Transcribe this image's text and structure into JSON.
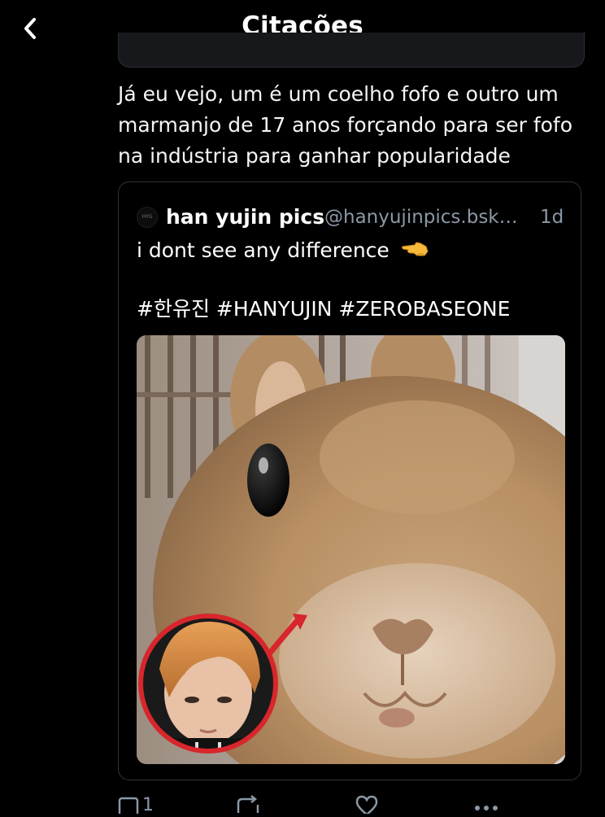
{
  "header": {
    "title": "Citações",
    "back_icon": "chevron-left-icon"
  },
  "post": {
    "text": "Já eu vejo, um é um coelho fofo e outro um marmanjo de 17 anos forçando para ser fofo na indústria para ganhar popularidade"
  },
  "quoted_post": {
    "avatar_text": "HYG",
    "author": "han yujin pics",
    "handle": "@hanyujinpics.bsk…",
    "time": "1d",
    "text": "i dont see any difference",
    "emoji_icon": "pointing-hand-icon",
    "hashtags": "#한유진 #HANYUJIN #ZEROBASEONE",
    "image_icon": "rabbit-photo"
  },
  "actions": {
    "reply_icon": "reply-icon",
    "reply_count": "1",
    "repost_icon": "repost-icon",
    "like_icon": "heart-icon",
    "more_icon": "more-icon"
  },
  "colors": {
    "background": "#000000",
    "text": "#ffffff",
    "secondary_text": "#8b98a5",
    "border": "#2f3336",
    "highlight_circle": "#d7262c"
  }
}
